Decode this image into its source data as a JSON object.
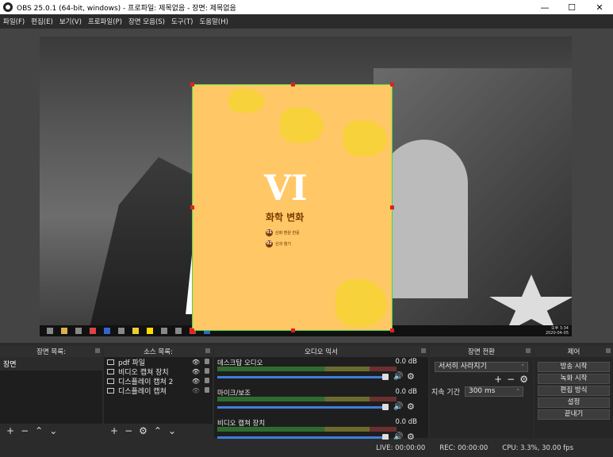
{
  "window": {
    "title": "OBS 25.0.1 (64-bit, windows) - 프로파일: 제목없음 - 장면: 제목없음",
    "minimize": "—",
    "maximize": "☐",
    "close": "✕"
  },
  "menu": [
    "파일(F)",
    "편집(E)",
    "보기(V)",
    "프로파일(P)",
    "장면 모음(S)",
    "도구(T)",
    "도움말(H)"
  ],
  "preview": {
    "slide": {
      "numeral": "VI",
      "chapter": "화학 변화",
      "items": [
        {
          "num": "01",
          "text": "산화 환원 반응"
        },
        {
          "num": "02",
          "text": "산과 염기"
        }
      ]
    },
    "taskbar_time": "오후 3:34",
    "taskbar_date": "2020-04-05"
  },
  "docks": {
    "scenes": {
      "title": "장면 목록:",
      "items": [
        "장면"
      ]
    },
    "sources": {
      "title": "소스 목록:",
      "items": [
        "pdf 파일",
        "비디오 캡쳐 장치",
        "디스플레이 캡쳐 2",
        "디스플레이 캡쳐"
      ]
    },
    "mixer": {
      "title": "오디오 믹서",
      "channels": [
        {
          "name": "데스크탑 오디오",
          "db": "0.0 dB"
        },
        {
          "name": "마이크/보조",
          "db": "0.0 dB"
        },
        {
          "name": "비디오 캡쳐 장치",
          "db": "0.0 dB"
        }
      ]
    },
    "transitions": {
      "title": "장면 전환",
      "selected": "서서히 사라지기",
      "duration_label": "지속 기간",
      "duration_value": "300 ms"
    },
    "controls": {
      "title": "제어",
      "buttons": [
        "방송 시작",
        "녹화 시작",
        "편집 방식",
        "설정",
        "끝내기"
      ]
    }
  },
  "status": {
    "live": "LIVE: 00:00:00",
    "rec": "REC: 00:00:00",
    "cpu": "CPU: 3.3%, 30.00 fps"
  }
}
